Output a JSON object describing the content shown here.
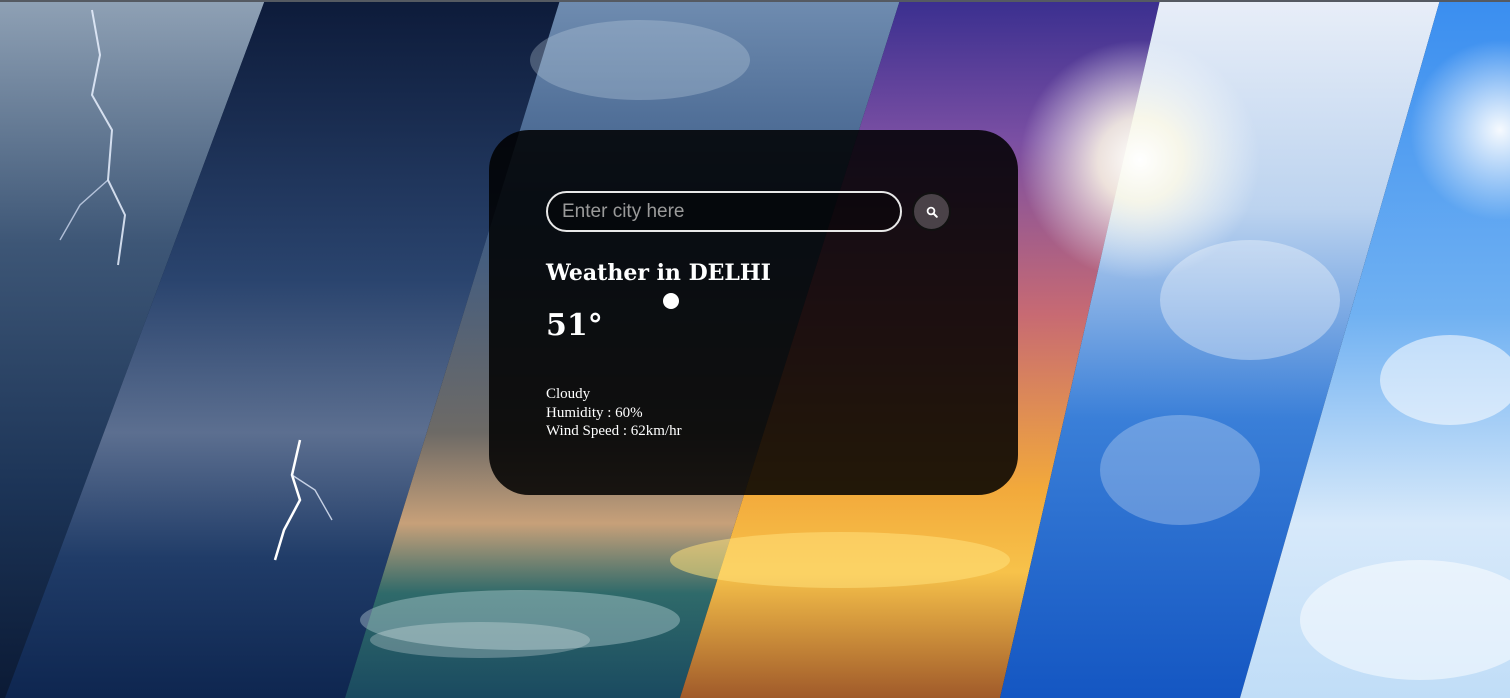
{
  "search": {
    "placeholder": "Enter city here",
    "value": "",
    "button_icon": "search-icon"
  },
  "weather": {
    "title": "Weather in DELHI",
    "icon": "weather-condition-icon",
    "temperature": "51°",
    "description": "Cloudy",
    "humidity": "Humidity : 60%",
    "wind_speed": "Wind Speed : 62km/hr"
  },
  "colors": {
    "card_background": "#000000",
    "text": "#ffffff",
    "search_button": "#4a4248",
    "input_border": "#e8e8e8"
  }
}
